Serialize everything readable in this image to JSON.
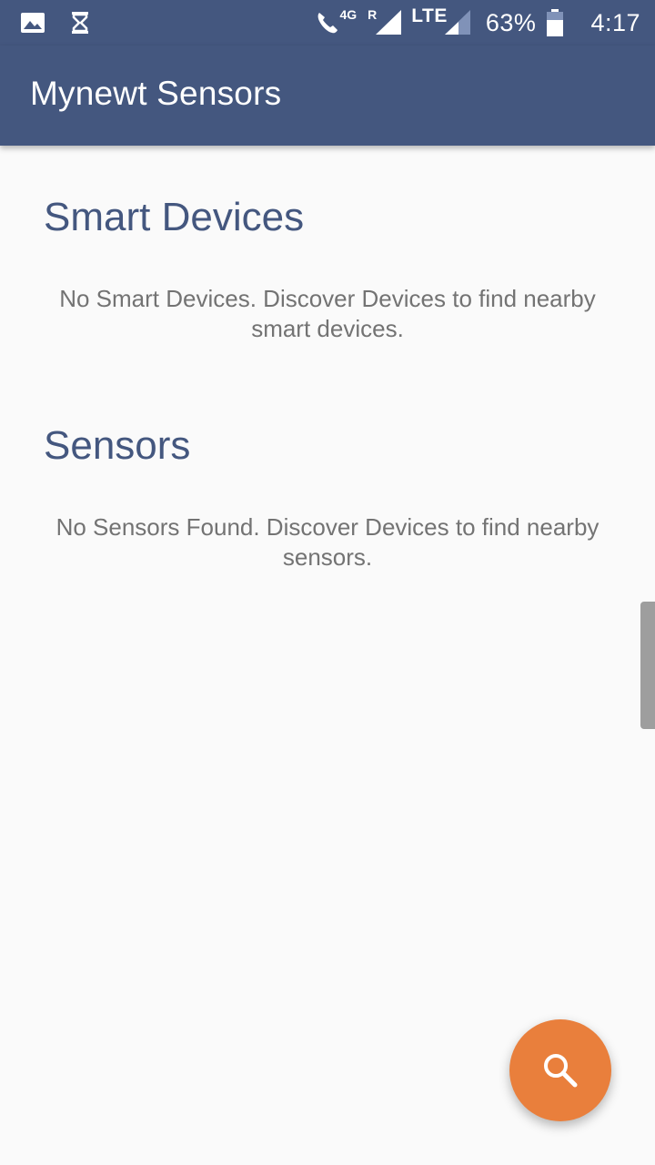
{
  "status_bar": {
    "network_4g": "4G",
    "roaming": "R",
    "network_lte": "LTE",
    "battery_percent": "63%",
    "time": "4:17",
    "icons": [
      "image-icon",
      "hourglass-icon",
      "wifi-call-icon",
      "signal-icon",
      "battery-icon"
    ]
  },
  "app_bar": {
    "title": "Mynewt Sensors"
  },
  "smart_devices": {
    "title": "Smart Devices",
    "empty_message": "No Smart Devices. Discover Devices to find nearby smart devices."
  },
  "sensors": {
    "title": "Sensors",
    "empty_message": "No Sensors Found. Discover Devices to find nearby sensors."
  },
  "fab": {
    "icon": "search-icon"
  },
  "colors": {
    "primary": "#44577f",
    "accent": "#e97f3c",
    "background": "#fafafa",
    "secondary_text": "#737373"
  }
}
